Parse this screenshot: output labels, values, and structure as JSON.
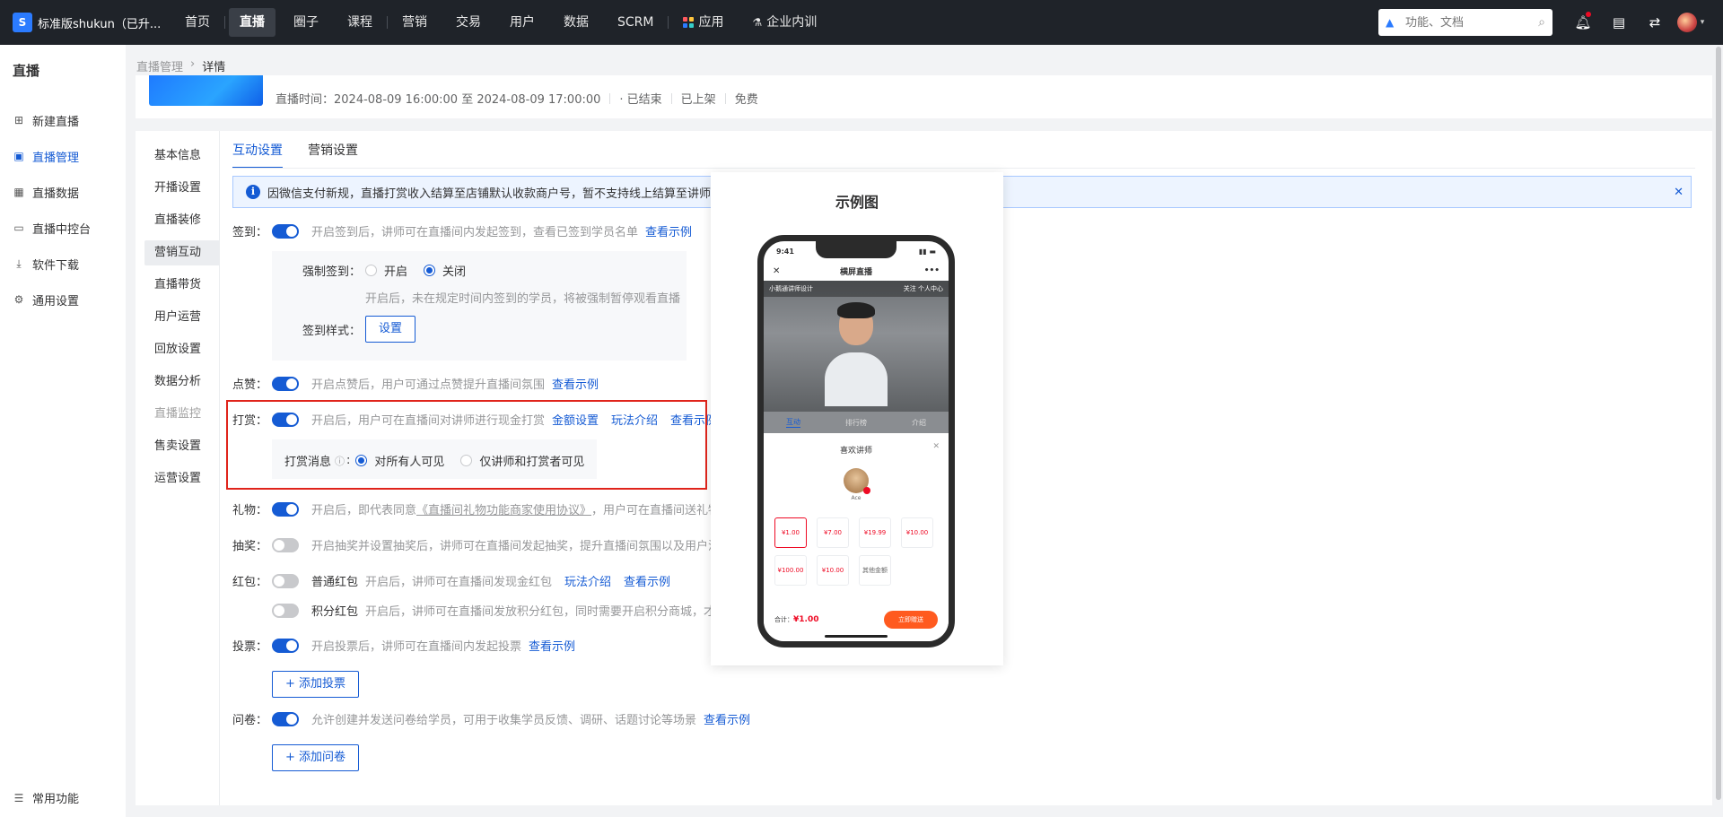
{
  "app": {
    "brand": "标准版shukun（已升...",
    "brand_logo_letter": "S",
    "nav": [
      {
        "label": "首页"
      },
      {
        "label": "直播",
        "active": true
      },
      {
        "label": "圈子"
      },
      {
        "label": "课程"
      },
      {
        "label": "营销"
      },
      {
        "label": "交易"
      },
      {
        "label": "用户"
      },
      {
        "label": "数据"
      },
      {
        "label": "SCRM"
      },
      {
        "label": "应用"
      },
      {
        "label": "企业内训"
      }
    ],
    "search_placeholder": "功能、文档",
    "colors": {
      "primary": "#155bd4",
      "topbar": "#1f2329",
      "highlight": "#e0241b"
    }
  },
  "sidebar": {
    "title": "直播",
    "items": [
      {
        "label": "新建直播",
        "icon": "plus-square-icon"
      },
      {
        "label": "直播管理",
        "icon": "list-square-icon",
        "active": true
      },
      {
        "label": "直播数据",
        "icon": "data-icon"
      },
      {
        "label": "直播中控台",
        "icon": "monitor-icon"
      },
      {
        "label": "软件下载",
        "icon": "download-icon"
      },
      {
        "label": "通用设置",
        "icon": "gear-icon"
      }
    ],
    "bottom": "常用功能"
  },
  "breadcrumb": {
    "parent": "直播管理",
    "current": "详情"
  },
  "live_info": {
    "time": "直播时间：2024-08-09 16:00:00 至 2024-08-09 17:00:00",
    "status": "· 已结束",
    "shelf": "已上架",
    "price": "免费"
  },
  "sub_menu": [
    {
      "label": "基本信息"
    },
    {
      "label": "开播设置"
    },
    {
      "label": "直播装修"
    },
    {
      "label": "营销互动",
      "active": true
    },
    {
      "label": "直播带货"
    },
    {
      "label": "用户运营"
    },
    {
      "label": "回放设置"
    },
    {
      "label": "数据分析"
    },
    {
      "label": "直播监控",
      "disabled": true
    },
    {
      "label": "售卖设置"
    },
    {
      "label": "运营设置"
    }
  ],
  "tabs": [
    {
      "label": "互动设置",
      "active": true
    },
    {
      "label": "营销设置"
    }
  ],
  "notice": "因微信支付新规，直播打赏收入结算至店铺默认收款商户号，暂不支持线上结算至讲师账",
  "settings": {
    "checkin": {
      "label": "签到：",
      "enabled": true,
      "desc": "开启签到后，讲师可在直播间内发起签到，查看已签到学员名单",
      "link": "查看示例",
      "force_label": "强制签到：",
      "force_on": "开启",
      "force_off": "关闭",
      "force_value": "关闭",
      "force_hint": "开启后，未在规定时间内签到的学员，将被强制暂停观看直播",
      "style_label": "签到样式：",
      "style_button": "设置"
    },
    "like": {
      "label": "点赞：",
      "enabled": true,
      "desc": "开启点赞后，用户可通过点赞提升直播间氛围",
      "link": "查看示例"
    },
    "reward": {
      "label": "打赏：",
      "enabled": true,
      "desc": "开启后，用户可在直播间对讲师进行现金打赏",
      "links": [
        "金额设置",
        "玩法介绍",
        "查看示例"
      ],
      "msg_label": "打赏消息",
      "opt_all": "对所有人可见",
      "opt_private": "仅讲师和打赏者可见",
      "msg_value": "对所有人可见"
    },
    "gift": {
      "label": "礼物：",
      "enabled": true,
      "desc_pre": "开启后，即代表同意",
      "desc_link": "《直播间礼物功能商家使用协议》",
      "desc_post": "，用户可在直播间送礼物"
    },
    "lottery": {
      "label": "抽奖：",
      "enabled": false,
      "desc": "开启抽奖并设置抽奖后，讲师可在直播间发起抽奖，提升直播间氛围以及用户活跃"
    },
    "redpacket": {
      "label": "红包：",
      "normal": {
        "enabled": false,
        "name": "普通红包",
        "desc": "开启后，讲师可在直播间发现金红包",
        "links": [
          "玩法介绍",
          "查看示例"
        ]
      },
      "points": {
        "enabled": false,
        "name": "积分红包",
        "desc": "开启后，讲师可在直播间发放积分红包，同时需要开启积分商城，才能"
      }
    },
    "vote": {
      "label": "投票：",
      "enabled": true,
      "desc": "开启投票后，讲师可在直播间内发起投票",
      "link": "查看示例",
      "add_button": "+ 添加投票"
    },
    "survey": {
      "label": "问卷：",
      "enabled": true,
      "desc": "允许创建并发送问卷给学员，可用于收集学员反馈、调研、话题讨论等场景",
      "link": "查看示例",
      "add_button": "+ 添加问卷"
    }
  },
  "example": {
    "title": "示例图",
    "phone": {
      "time": "9:41",
      "nav_title": "横屏直播",
      "channel": "小鹅通讲师设计",
      "follow": "关注",
      "center": "个人中心",
      "tabs": [
        "互动",
        "排行榜",
        "介绍"
      ],
      "sheet_title": "喜欢讲师",
      "teacher": "Ace",
      "amounts": [
        "¥1.00",
        "¥7.00",
        "¥19.99",
        "¥10.00",
        "¥100.00",
        "¥10.00",
        "其他金额"
      ],
      "selected": "¥1.00",
      "total_label": "合计：",
      "total": "¥1.00",
      "button": "立即赠送"
    }
  }
}
